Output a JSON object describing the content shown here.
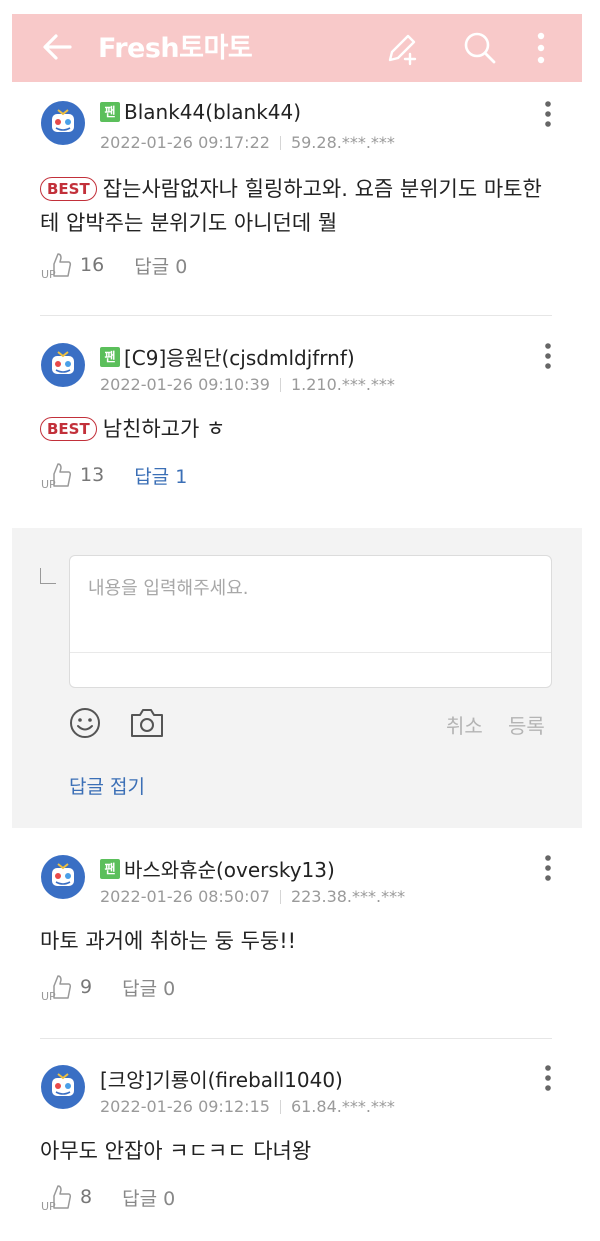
{
  "header": {
    "title": "Fresh토마토",
    "back_icon": "back-arrow-icon",
    "write_icon": "pencil-plus-icon",
    "search_icon": "search-icon",
    "more_icon": "more-vertical-icon",
    "color": "#f8c9c9"
  },
  "comments": [
    {
      "fan_badge": "팬",
      "author": "Blank44(blank44)",
      "date": "2022-01-26 09:17:22",
      "ip": "59.28.***.***",
      "best_label": "BEST",
      "text": "잡는사람없자나 힐링하고와. 요즘 분위기도 마토한테 압박주는 분위기도 아니던데 뭘",
      "up_label": "UP",
      "up_count": "16",
      "reply_label": "답글",
      "reply_count": "0"
    },
    {
      "fan_badge": "팬",
      "author": "[C9]응원단(cjsdmldjfrnf)",
      "date": "2022-01-26 09:10:39",
      "ip": "1.210.***.***",
      "best_label": "BEST",
      "text": "남친하고가 ㅎ",
      "up_label": "UP",
      "up_count": "13",
      "reply_label": "답글",
      "reply_count": "1"
    },
    {
      "fan_badge": "팬",
      "author": "바스와휴순(oversky13)",
      "date": "2022-01-26 08:50:07",
      "ip": "223.38.***.***",
      "text": "마토 과거에 취하는 둥 두둥!!",
      "up_label": "UP",
      "up_count": "9",
      "reply_label": "답글",
      "reply_count": "0"
    },
    {
      "author": "[크앙]기룡이(fireball1040)",
      "date": "2022-01-26 09:12:15",
      "ip": "61.84.***.***",
      "text": "아무도 안잡아 ㅋㄷㅋㄷ 다녀왕",
      "up_label": "UP",
      "up_count": "8",
      "reply_label": "답글",
      "reply_count": "0"
    }
  ],
  "reply_form": {
    "placeholder": "내용을 입력해주세요.",
    "emoji_icon": "emoji-icon",
    "camera_icon": "camera-icon",
    "cancel_label": "취소",
    "submit_label": "등록",
    "fold_label": "답글 접기"
  },
  "colors": {
    "best": "#c2303a",
    "link": "#3b6fb6",
    "fan_badge": "#5bbf5b"
  }
}
